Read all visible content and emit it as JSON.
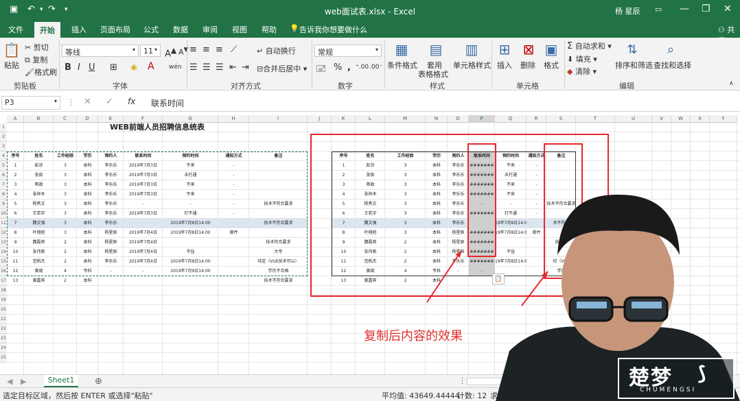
{
  "title_bar": {
    "filename": "web面试表.xlsx",
    "app": "Excel",
    "user": "杨 星辰",
    "sep": "-"
  },
  "tabs": [
    "文件",
    "开始",
    "插入",
    "页面布局",
    "公式",
    "数据",
    "审阅",
    "视图",
    "帮助"
  ],
  "tell_me": "告诉我你想要做什么",
  "share": "共享",
  "ribbon": {
    "clipboard": {
      "paste": "粘贴",
      "cut": "剪切",
      "copy": "复制",
      "format_painter": "格式刷",
      "group": "剪贴板"
    },
    "font": {
      "name": "等线",
      "size": "11",
      "group": "字体"
    },
    "align": {
      "wrap": "自动换行",
      "merge": "合并后居中",
      "group": "对齐方式"
    },
    "number": {
      "format": "常规",
      "group": "数字"
    },
    "styles": {
      "cond": "条件格式",
      "table_1": "套用",
      "table_2": "表格格式",
      "cell": "单元格样式",
      "group": "样式"
    },
    "cells": {
      "insert": "插入",
      "delete": "删除",
      "format": "格式",
      "group": "单元格"
    },
    "editing": {
      "autosum": "自动求和",
      "fill": "填充",
      "clear": "清除",
      "sort": "排序和筛选",
      "find": "查找和选择",
      "group": "编辑"
    }
  },
  "formula_bar": {
    "name_box": "P3",
    "fx": "fx",
    "value": "联系时间"
  },
  "left_cols": [
    "A",
    "B",
    "C",
    "D",
    "E",
    "F",
    "G",
    "H",
    "I"
  ],
  "right_cols": [
    "J",
    "K",
    "L",
    "M",
    "N",
    "O",
    "P",
    "Q",
    "R",
    "S",
    "T",
    "U",
    "V",
    "W",
    "X",
    "Y"
  ],
  "rows": [
    "1",
    "2",
    "3",
    "4",
    "5",
    "6",
    "7",
    "8",
    "9",
    "10",
    "11",
    "12",
    "13",
    "14",
    "15",
    "16",
    "17",
    "18",
    "19",
    "20",
    "21",
    "22",
    "23",
    "24",
    "25"
  ],
  "left_table": {
    "title": "WEB前端人员招聘信息统表",
    "headers": [
      "序号",
      "姓名",
      "工作经验",
      "学历",
      "预约人",
      "联系时间",
      "预约时间",
      "通知方式",
      "备注"
    ],
    "rows": [
      [
        "1",
        "彭凉",
        "3",
        "本科",
        "李乐乐",
        "2019年7月3日",
        "不来",
        "-",
        ""
      ],
      [
        "2",
        "张俊",
        "3",
        "本科",
        "李乐乐",
        "2019年7月3日",
        "未打通",
        "-",
        ""
      ],
      [
        "3",
        "蒋政",
        "3",
        "本科",
        "李乐乐",
        "2019年7月3日",
        "不来",
        "-",
        ""
      ],
      [
        "4",
        "张祥木",
        "3",
        "本科",
        "李乐乐",
        "2019年7月3日",
        "不来",
        "-",
        ""
      ],
      [
        "5",
        "杨秀文",
        "3",
        "本科",
        "李乐乐",
        "-",
        "-",
        "-",
        "技术不符合要求"
      ],
      [
        "6",
        "王若宇",
        "3",
        "本科",
        "李乐乐",
        "2019年7月3日",
        "打不通",
        "-",
        ""
      ],
      [
        "7",
        "魏文强",
        "3",
        "本科",
        "李乐乐",
        "",
        "2019年7月8日14:00",
        "",
        "技术不符合要求"
      ],
      [
        "8",
        "叶翔旭",
        "3",
        "本科",
        "杨星辰",
        "2019年7月4日",
        "2019年7月8日14:00",
        "邮件",
        ""
      ],
      [
        "9",
        "魏磊宾",
        "2",
        "本科",
        "杨星辰",
        "2019年7月4日",
        "",
        "",
        "技术符合要求"
      ],
      [
        "10",
        "张伟刚",
        "2",
        "本科",
        "杨星辰",
        "2019年7月4日",
        "不挂",
        "",
        "大专"
      ],
      [
        "11",
        "范帆杰",
        "2",
        "本科",
        "李乐乐",
        "2019年7月4日",
        "2019年7月8日14:00",
        "",
        "待定（VUE技术可以）"
      ],
      [
        "12",
        "黄斌",
        "4",
        "专科",
        "-",
        "-",
        "2019年7月9日14:00",
        "",
        "学历不合格"
      ],
      [
        "13",
        "黄嘉宾",
        "2",
        "本科",
        "",
        "",
        "",
        "",
        "技术不符合要求"
      ]
    ]
  },
  "right_table": {
    "headers": [
      "序号",
      "姓名",
      "工作经验",
      "学历",
      "预约人",
      "联系时间",
      "预约时间",
      "通知方式",
      "备注"
    ],
    "rows": [
      [
        "1",
        "彭凉",
        "3",
        "本科",
        "李乐乐",
        "#######",
        "不来",
        "-",
        ""
      ],
      [
        "2",
        "张俊",
        "3",
        "本科",
        "李乐乐",
        "#######",
        "未打通",
        "-",
        ""
      ],
      [
        "3",
        "蒋政",
        "3",
        "本科",
        "李乐乐",
        "#######",
        "不来",
        "-",
        ""
      ],
      [
        "4",
        "张祥木",
        "3",
        "本科",
        "李乐乐",
        "#######",
        "不来",
        "-",
        ""
      ],
      [
        "5",
        "杨秀文",
        "3",
        "本科",
        "李乐乐",
        "-",
        "-",
        "-",
        "技术不符合要求"
      ],
      [
        "6",
        "王若宇",
        "3",
        "本科",
        "李乐乐",
        "#######",
        "打不通",
        "-",
        ""
      ],
      [
        "7",
        "魏文强",
        "3",
        "本科",
        "李乐乐",
        "",
        "19年7月8日14:00",
        "",
        "术不符合"
      ],
      [
        "8",
        "叶翔旭",
        "3",
        "本科",
        "杨星辰",
        "#######",
        "19年7月8日14:00",
        "邮件",
        ""
      ],
      [
        "9",
        "魏磊宾",
        "2",
        "本科",
        "杨星辰",
        "#######",
        "",
        "",
        "技术符"
      ],
      [
        "10",
        "张伟刚",
        "2",
        "本科",
        "杨星辰",
        "#######",
        "不挂",
        "",
        ""
      ],
      [
        "11",
        "范帆杰",
        "2",
        "本科",
        "李乐乐",
        "#######",
        "19年7月8日14:00",
        "",
        "待（VUE"
      ],
      [
        "12",
        "黄斌",
        "4",
        "专科",
        "-",
        "-",
        "",
        "",
        "学历"
      ],
      [
        "13",
        "黄嘉宾",
        "2",
        "本科",
        "",
        "",
        "",
        "",
        ""
      ]
    ]
  },
  "annotation": "复制后内容的效果",
  "sheet_tab": "Sheet1",
  "status": {
    "message": "选定目标区域，然后按 ENTER 或选择\"粘贴\"",
    "average": "平均值: 43649.44444",
    "count": "计数: 12",
    "extra": "求"
  },
  "watermark": {
    "brand": "楚梦",
    "sub": "CHUMENGSI"
  },
  "colors": {
    "excel_green": "#217346",
    "annotation_red": "#e8262a",
    "annotation_text": "#e0302c"
  }
}
